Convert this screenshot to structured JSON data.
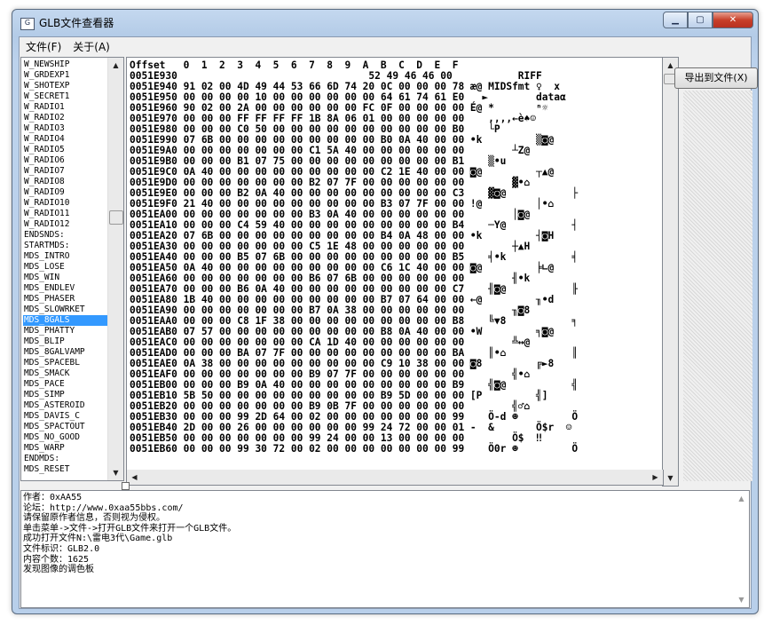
{
  "window": {
    "title": "GLB文件查看器",
    "icon": "app-icon"
  },
  "menu": {
    "file": "文件(F)",
    "about": "关于(A)"
  },
  "export_button": "导出到文件(X)",
  "list": {
    "selected_index": 24,
    "items": [
      "W_NEWSHIP",
      "W_GRDEXP1",
      "W_SHOTEXP",
      "W_SECRET1",
      "W_RADIO1",
      "W_RADIO2",
      "W_RADIO3",
      "W_RADIO4",
      "W_RADIO5",
      "W_RADIO6",
      "W_RADIO7",
      "W_RADIO8",
      "W_RADIO9",
      "W_RADIO10",
      "W_RADIO11",
      "W_RADIO12",
      "ENDSNDS:",
      "STARTMDS:",
      "MDS_INTRO",
      "MDS_LOSE",
      "MDS_WIN",
      "MDS_ENDLEV",
      "MDS_PHASER",
      "MDS_SLOWRKET",
      "MDS_8GALS",
      "MDS_PHATTY",
      "MDS_BLIP",
      "MDS_8GALVAMP",
      "MDS_SPACEBL",
      "MDS_SMACK",
      "MDS_PACE",
      "MDS_SIMP",
      "MDS_ASTEROID",
      "MDS_DAVIS_C",
      "MDS_SPACTOUT",
      "MDS_NO_GOOD",
      "MDS_WARP",
      "ENDMDS:",
      "MDS_RESET"
    ]
  },
  "hex": {
    "header": "Offset   0  1  2  3  4  5  6  7  8  9  A  B  C  D  E  F",
    "rows": [
      "0051E930                                52 49 46 46 00           RIFF",
      "0051E940 91 02 00 4D 49 44 53 66 6D 74 20 0C 00 00 00 78 æ@ MIDSfmt ♀  x",
      "0051E950 00 00 00 00 10 00 00 00 00 00 00 64 61 74 61 E0   ►        dataα",
      "0051E960 90 02 00 2A 00 00 00 00 00 00 FC 0F 00 00 00 00 É@ *       ⁿ☼",
      "0051E970 00 00 00 FF FF FF FF 1B 8A 06 01 00 00 00 00 00    ,,,,←è♠☺",
      "0051E980 00 00 00 C0 50 00 00 00 00 00 00 00 00 00 00 B0    └P",
      "0051E990 07 6B 00 00 00 00 00 00 00 00 00 B0 0A 40 00 00 •k         ▒◙@",
      "0051E9A0 00 00 00 00 00 00 00 C1 5A 40 00 00 00 00 00 00        ┴Z@",
      "0051E9B0 00 00 00 B1 07 75 00 00 00 00 00 00 00 00 00 B1    ▒•u",
      "0051E9C0 0A 40 00 00 00 00 00 00 00 00 00 C2 1E 40 00 00 ◙@         ┬▲@",
      "0051E9D0 00 00 00 00 00 00 00 B2 07 7F 00 00 00 00 00 00        ▓•⌂",
      "0051E9E0 00 00 00 B2 0A 40 00 00 00 00 00 00 00 00 00 C3    ▓◙@           ├",
      "0051E9F0 21 40 00 00 00 00 00 00 00 00 00 B3 07 7F 00 00 !@         │•⌂",
      "0051EA00 00 00 00 00 00 00 00 B3 0A 40 00 00 00 00 00 00        │◙@",
      "0051EA10 00 00 00 C4 59 40 00 00 00 00 00 00 00 00 00 B4    ─Y@           ┤",
      "0051EA20 07 6B 00 00 00 00 00 00 00 00 00 B4 0A 48 00 00 •k         ┤◙H",
      "0051EA30 00 00 00 00 00 00 00 C5 1E 48 00 00 00 00 00 00        ┼▲H",
      "0051EA40 00 00 00 B5 07 6B 00 00 00 00 00 00 00 00 00 B5    ╡•k           ╡",
      "0051EA50 0A 40 00 00 00 00 00 00 00 00 00 C6 1C 40 00 00 ◙@         ╞∟@",
      "0051EA60 00 00 00 00 00 00 00 B6 07 6B 00 00 00 00 00 00        ╢•k",
      "0051EA70 00 00 00 B6 0A 40 00 00 00 00 00 00 00 00 00 C7    ╢◙@           ╟",
      "0051EA80 1B 40 00 00 00 00 00 00 00 00 00 B7 07 64 00 00 ←@         ╖•d",
      "0051EA90 00 00 00 00 00 00 00 B7 0A 38 00 00 00 00 00 00        ╖◙8",
      "0051EAA0 00 00 00 C8 1F 38 00 00 00 00 00 00 00 00 00 B8    ╚▼8           ╕",
      "0051EAB0 07 57 00 00 00 00 00 00 00 00 00 B8 0A 40 00 00 •W         ╕◙@",
      "0051EAC0 00 00 00 00 00 00 00 CA 1D 40 00 00 00 00 00 00        ╩↔@",
      "0051EAD0 00 00 00 BA 07 7F 00 00 00 00 00 00 00 00 00 BA    ║•⌂           ║",
      "0051EAE0 0A 38 00 00 00 00 00 00 00 00 00 C9 10 38 00 00 ◙8         ╔►8",
      "0051EAF0 00 00 00 00 00 00 00 B9 07 7F 00 00 00 00 00 00        ╣•⌂",
      "0051EB00 00 00 00 B9 0A 40 00 00 00 00 00 00 00 00 00 B9    ╣◙@           ╣",
      "0051EB10 5B 50 00 00 00 00 00 00 00 00 00 B9 5D 00 00 00 [P         ╣]",
      "0051EB20 00 00 00 00 00 00 00 B9 0B 7F 00 00 00 00 00 00        ╣♂⌂",
      "0051EB30 00 00 00 99 2D 64 00 02 00 00 00 00 00 00 00 99    Ö-d ☻         Ö",
      "0051EB40 2D 00 00 26 00 00 00 00 00 00 99 24 72 00 00 01 -  &       Ö$r  ☺",
      "0051EB50 00 00 00 00 00 00 00 99 24 00 00 13 00 00 00 00        Ö$  ‼",
      "0051EB60 00 00 00 99 30 72 00 02 00 00 00 00 00 00 00 99    Ö0r ☻         Ö"
    ]
  },
  "log": {
    "lines": [
      "作者：0xAA55",
      "论坛：http://www.0xaa55bbs.com/",
      "请保留原作者信息，否则视为侵权。",
      "单击菜单->文件->打开GLB文件来打开一个GLB文件。",
      "成功打开文件N:\\雷电3代\\Game.glb",
      "文件标识：GLB2.0",
      "内容个数：1625",
      "发现图像的调色板"
    ]
  }
}
